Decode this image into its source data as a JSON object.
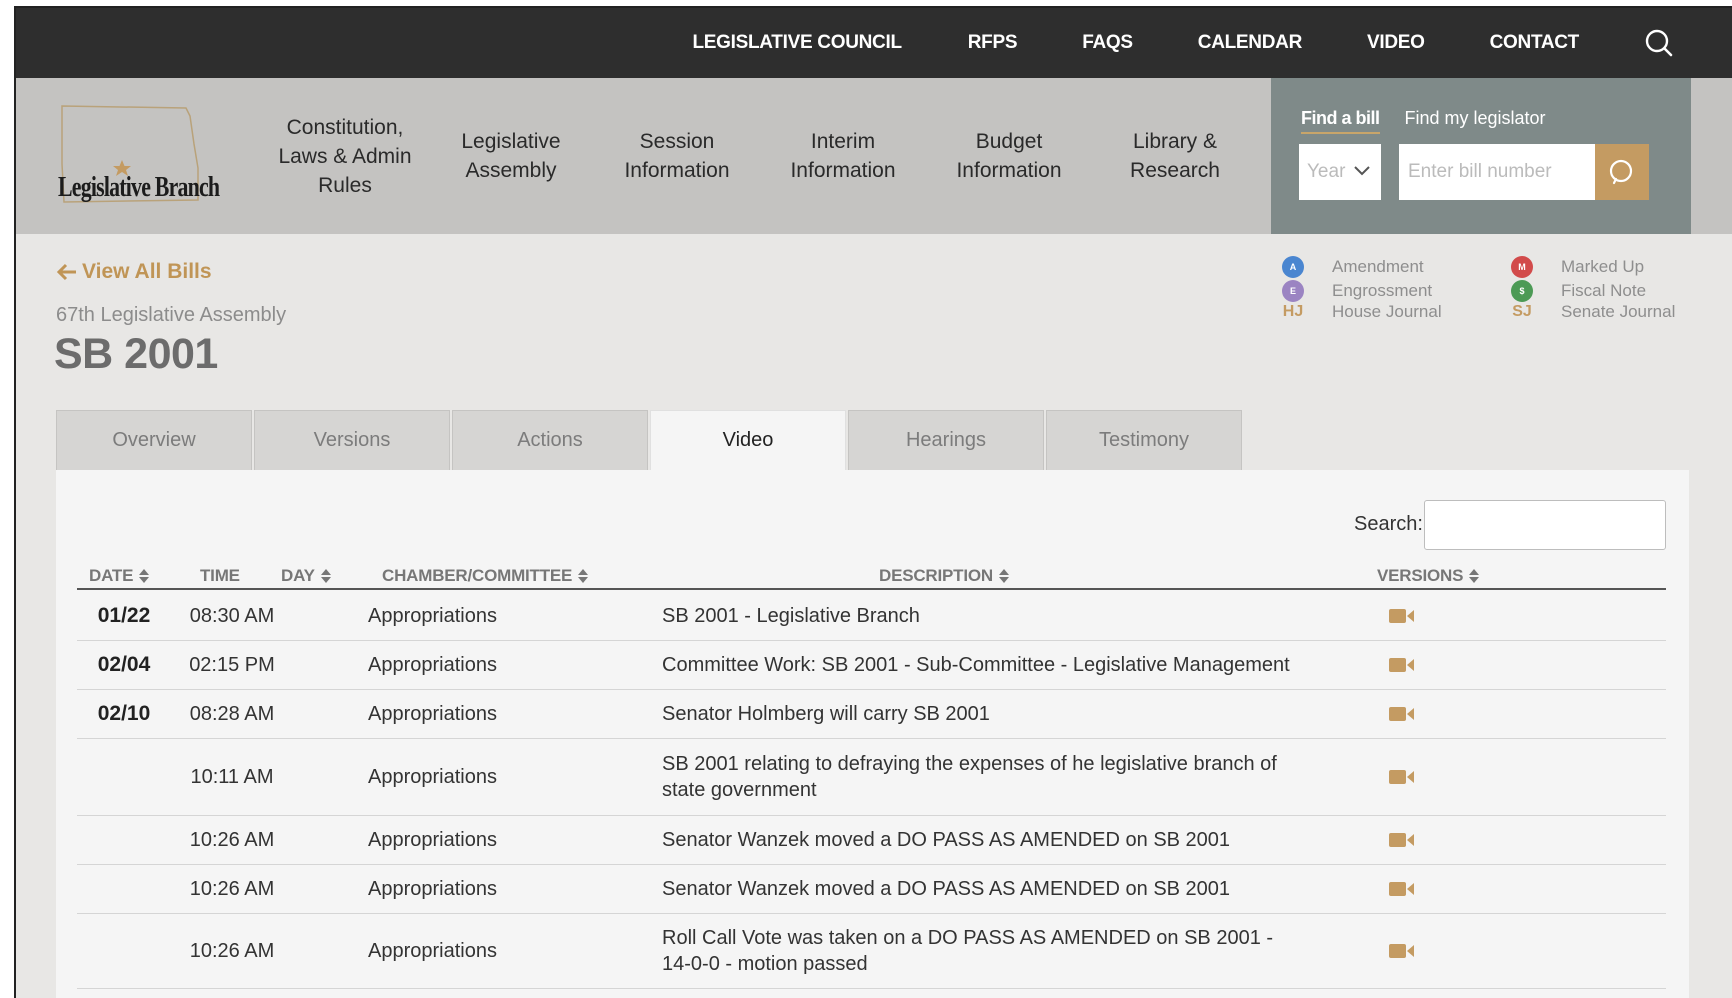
{
  "topnav": [
    "LEGISLATIVE COUNCIL",
    "RFPS",
    "FAQS",
    "CALENDAR",
    "VIDEO",
    "CONTACT"
  ],
  "logo": {
    "text": "Legislative Branch"
  },
  "mainnav": [
    [
      "Constitution,",
      "Laws & Admin",
      "Rules"
    ],
    [
      "Legislative",
      "Assembly"
    ],
    [
      "Session",
      "Information"
    ],
    [
      "Interim",
      "Information"
    ],
    [
      "Budget",
      "Information"
    ],
    [
      "Library &",
      "Research"
    ]
  ],
  "find": {
    "tab_bill": "Find a bill",
    "tab_legislator": "Find my legislator",
    "year_label": "Year",
    "bill_placeholder": "Enter bill number"
  },
  "page": {
    "back_label": "View All Bills",
    "assembly": "67th Legislative Assembly",
    "bill": "SB 2001"
  },
  "legend": [
    {
      "mark": "A",
      "label": "Amendment",
      "color": "#4a86d0",
      "kind": "dot"
    },
    {
      "mark": "E",
      "label": "Engrossment",
      "color": "#9b84c2",
      "kind": "dot"
    },
    {
      "mark": "HJ",
      "label": "House Journal",
      "color": "#c49b62",
      "kind": "abbr"
    },
    {
      "mark": "M",
      "label": "Marked Up",
      "color": "#d24b4b",
      "kind": "dot"
    },
    {
      "mark": "$",
      "label": "Fiscal Note",
      "color": "#4c9a55",
      "kind": "dot"
    },
    {
      "mark": "SJ",
      "label": "Senate Journal",
      "color": "#c49b62",
      "kind": "abbr"
    }
  ],
  "tabs": [
    "Overview",
    "Versions",
    "Actions",
    "Video",
    "Hearings",
    "Testimony"
  ],
  "active_tab": "Video",
  "table": {
    "search_label": "Search:",
    "headers": [
      "DATE",
      "TIME",
      "DAY",
      "CHAMBER/COMMITTEE",
      "DESCRIPTION",
      "VERSIONS"
    ],
    "rows": [
      {
        "date": "01/22",
        "time": "08:30 AM",
        "committee": "Appropriations",
        "description": "SB 2001 - Legislative Branch"
      },
      {
        "date": "02/04",
        "time": "02:15 PM",
        "committee": "Appropriations",
        "description": "Committee Work: SB 2001 - Sub-Committee - Legislative Management"
      },
      {
        "date": "02/10",
        "time": "08:28 AM",
        "committee": "Appropriations",
        "description": "Senator Holmberg will carry SB 2001"
      },
      {
        "date": "",
        "time": "10:11 AM",
        "committee": "Appropriations",
        "description": "SB 2001 relating to defraying the expenses of he legislative branch of state government"
      },
      {
        "date": "",
        "time": "10:26 AM",
        "committee": "Appropriations",
        "description": "Senator Wanzek moved a DO PASS AS AMENDED on SB 2001"
      },
      {
        "date": "",
        "time": "10:26 AM",
        "committee": "Appropriations",
        "description": "Senator Wanzek moved a DO PASS AS AMENDED on SB 2001"
      },
      {
        "date": "",
        "time": "10:26 AM",
        "committee": "Appropriations",
        "description": "Roll Call Vote was taken on a DO PASS AS AMENDED on SB 2001 - 14-0-0 - motion passed"
      }
    ]
  }
}
